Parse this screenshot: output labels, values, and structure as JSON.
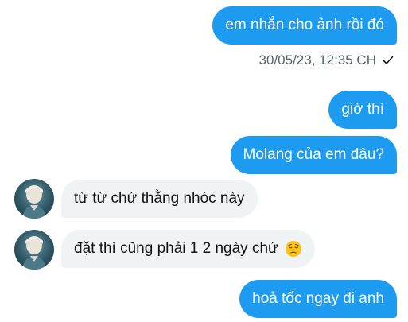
{
  "messages": [
    {
      "text": "em nhắn cho ảnh rồi đó",
      "from": "me"
    },
    {
      "text": "giờ thì",
      "from": "me"
    },
    {
      "text": "Molang của em đâu?",
      "from": "me"
    },
    {
      "text": "từ từ chứ thằng nhóc này",
      "from": "them"
    },
    {
      "text": "đặt thì cũng phải 1 2 ngày chứ",
      "from": "them",
      "emoji": "pensive-face"
    },
    {
      "text": "hoả tốc ngay đi anh",
      "from": "me"
    }
  ],
  "timestamp": "30/05/23, 12:35 CH",
  "status_icon": "checkmark-sent-icon",
  "colors": {
    "sent_bubble": "#1d9bf0",
    "received_bubble": "#eff3f4",
    "meta_text": "#536471"
  }
}
